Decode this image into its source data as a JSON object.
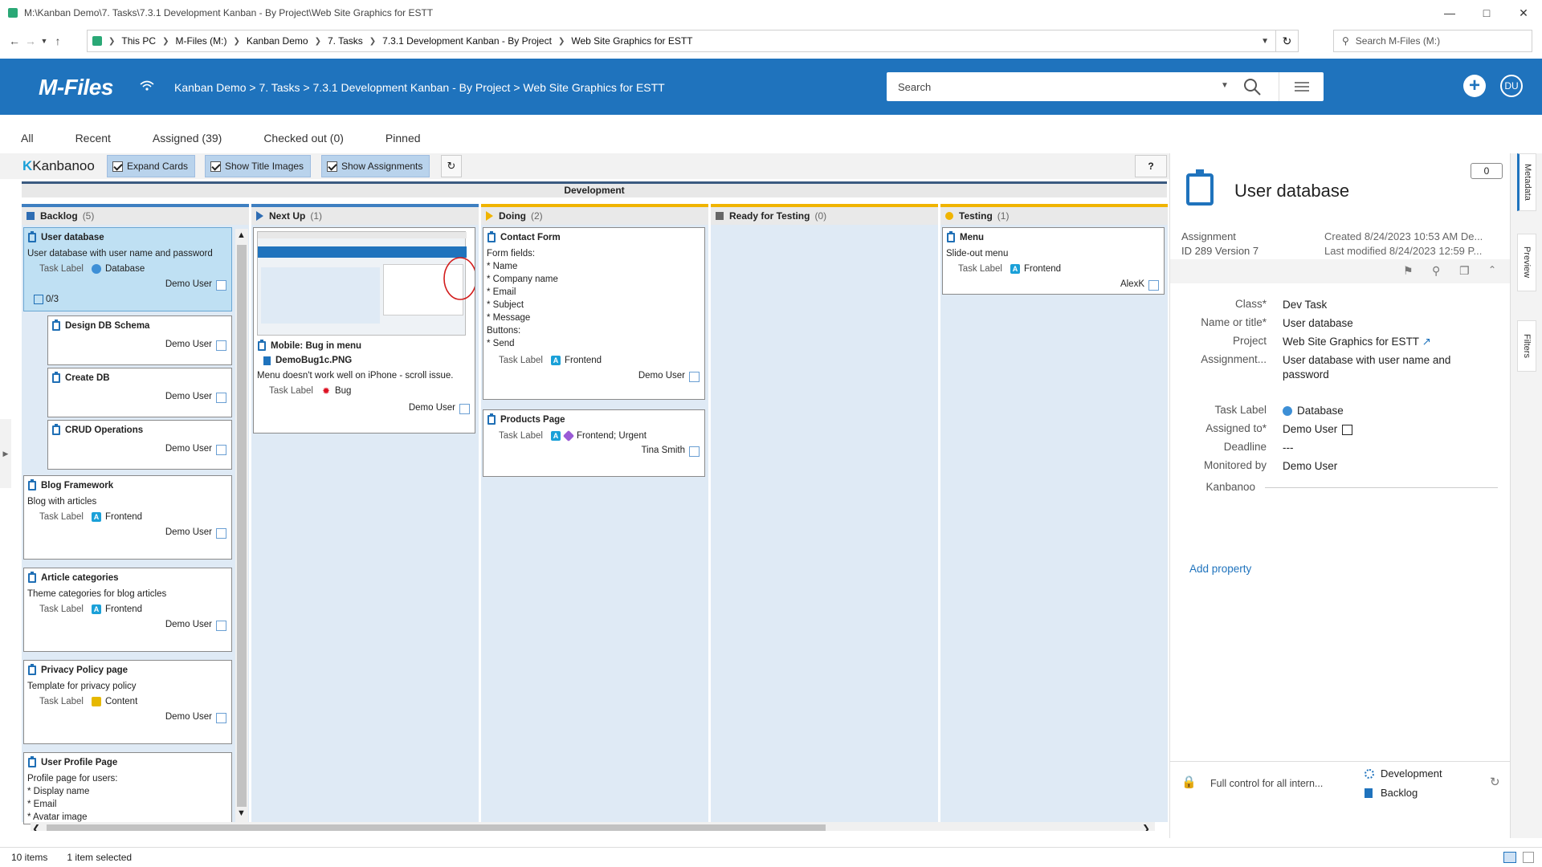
{
  "window": {
    "title": "M:\\Kanban Demo\\7. Tasks\\7.3.1 Development Kanban - By Project\\Web Site Graphics for ESTT"
  },
  "address": {
    "crumbs": [
      "This PC",
      "M-Files (M:)",
      "Kanban Demo",
      "7. Tasks",
      "7.3.1 Development Kanban - By Project",
      "Web Site Graphics for ESTT"
    ],
    "search_placeholder": "Search M-Files (M:)"
  },
  "header": {
    "logo": "M-Files",
    "path": "Kanban Demo > 7. Tasks > 7.3.1 Development Kanban - By Project > Web Site Graphics for ESTT",
    "search_placeholder": "Search",
    "avatar": "DU"
  },
  "tabs": [
    "All",
    "Recent",
    "Assigned (39)",
    "Checked out (0)",
    "Pinned"
  ],
  "kanban": {
    "logo": "Kanbanoo",
    "buttons": {
      "expand": "Expand Cards",
      "title_images": "Show Title Images",
      "assignments": "Show Assignments",
      "help": "?"
    },
    "swimlane": "Development",
    "columns": [
      {
        "name": "Backlog",
        "count": "(5)",
        "color": "#3e7fc1"
      },
      {
        "name": "Next Up",
        "count": "(1)",
        "color": "#3e7fc1"
      },
      {
        "name": "Doing",
        "count": "(2)",
        "color": "#f0b400"
      },
      {
        "name": "Ready for Testing",
        "count": "(0)",
        "color": "#f0b400"
      },
      {
        "name": "Testing",
        "count": "(1)",
        "color": "#f0b400"
      }
    ],
    "task_label_key": "Task Label",
    "cards": {
      "user_db": {
        "title": "User database",
        "desc": "User database with user name and password",
        "label": "Database",
        "user": "Demo User",
        "subtasks": "0/3"
      },
      "design_db": {
        "title": "Design DB Schema",
        "user": "Demo User"
      },
      "create_db": {
        "title": "Create DB",
        "user": "Demo User"
      },
      "crud": {
        "title": "CRUD Operations",
        "user": "Demo User"
      },
      "blog": {
        "title": "Blog Framework",
        "desc": "Blog with articles",
        "label": "Frontend",
        "user": "Demo User"
      },
      "article": {
        "title": "Article categories",
        "desc": "Theme categories for blog articles",
        "label": "Frontend",
        "user": "Demo User"
      },
      "privacy": {
        "title": "Privacy Policy page",
        "desc": "Template for privacy policy",
        "label": "Content",
        "user": "Demo User"
      },
      "profile": {
        "title": "User Profile Page",
        "desc_lines": [
          "Profile page for users:",
          "* Display name",
          "* Email",
          "* Avatar image"
        ]
      },
      "mobile_bug": {
        "title": "Mobile: Bug in menu",
        "file": "DemoBug1c.PNG",
        "desc": "Menu doesn't work well on iPhone - scroll issue.",
        "label": "Bug",
        "user": "Demo User"
      },
      "contact": {
        "title": "Contact Form",
        "desc_lines": [
          "Form fields:",
          "* Name",
          "* Company name",
          "* Email",
          "* Subject",
          "* Message",
          "Buttons:",
          "* Send"
        ],
        "label": "Frontend",
        "user": "Demo User"
      },
      "products": {
        "title": "Products Page",
        "label": "Frontend; Urgent",
        "user": "Tina Smith"
      },
      "menu": {
        "title": "Menu",
        "desc": "Slide-out menu",
        "label": "Frontend",
        "user": "AlexK"
      }
    }
  },
  "panel": {
    "title": "User database",
    "comment_count": "0",
    "type": "Assignment",
    "id_version": "ID 289  Version 7",
    "created": "Created 8/24/2023 10:53 AM De...",
    "modified": "Last modified 8/24/2023 12:59 P...",
    "props": [
      {
        "k": "Class*",
        "v": "Dev Task"
      },
      {
        "k": "Name or title*",
        "v": "User database"
      },
      {
        "k": "Project",
        "v": "Web Site Graphics for ESTT"
      },
      {
        "k": "Assignment...",
        "v": "User database with user name and password"
      },
      {
        "k": "Task Label",
        "v": "Database"
      },
      {
        "k": "Assigned to*",
        "v": "Demo User"
      },
      {
        "k": "Deadline",
        "v": "---"
      },
      {
        "k": "Monitored by",
        "v": "Demo User"
      },
      {
        "k": "Kanbanoo",
        "v": ""
      }
    ],
    "add_property": "Add property",
    "permissions": "Full control for all intern...",
    "workflow": "Development",
    "state": "Backlog",
    "side_tabs": [
      "Metadata",
      "Preview",
      "Filters"
    ]
  },
  "status": {
    "items": "10 items",
    "selected": "1 item selected"
  }
}
